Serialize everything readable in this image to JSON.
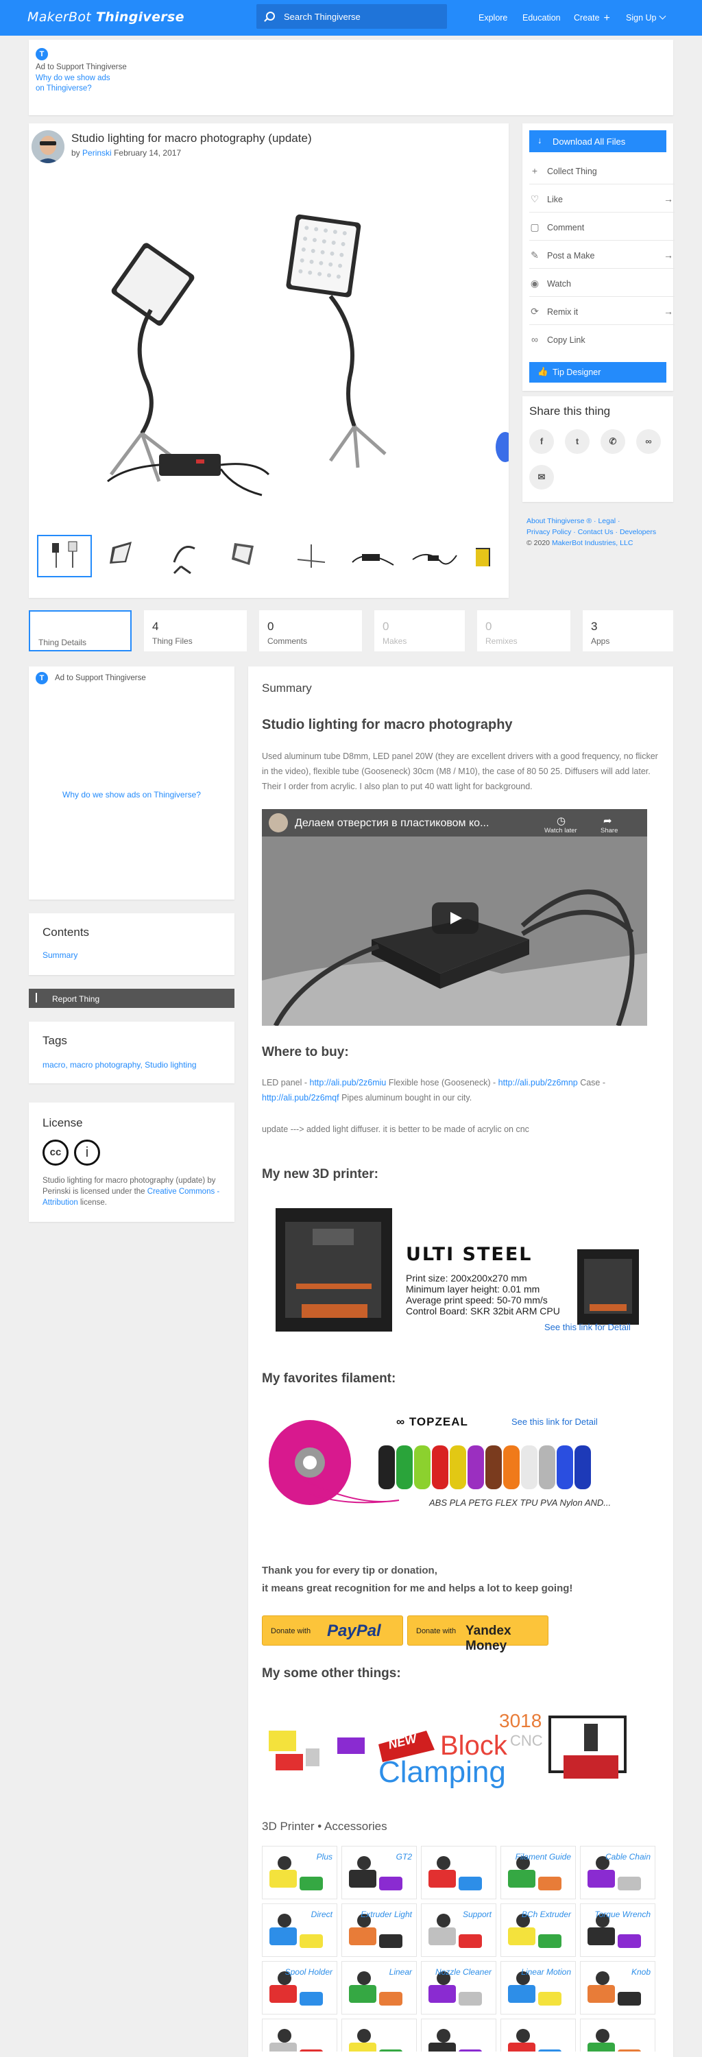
{
  "header": {
    "logo_brand": "MakerBot",
    "logo_product": "Thingiverse",
    "search_placeholder": "Search Thingiverse",
    "nav": [
      "Explore",
      "Education",
      "Create",
      "Sign Up"
    ]
  },
  "top_ad": {
    "label": "Ad to Support Thingiverse",
    "link_line1": "Why do we show ads",
    "link_line2": "on Thingiverse?"
  },
  "thing": {
    "title": "Studio lighting for macro photography (update)",
    "by": "by",
    "author": "Perinski",
    "date": "February 14, 2017"
  },
  "actions": {
    "download": "Download All Files",
    "items": [
      "Collect Thing",
      "Like",
      "Comment",
      "Post a Make",
      "Watch",
      "Remix it",
      "Copy Link"
    ],
    "tip": "Tip Designer"
  },
  "share": {
    "title": "Share this thing",
    "icons": [
      "facebook-icon",
      "twitter-icon",
      "whatsapp-icon",
      "link-icon",
      "mail-icon"
    ]
  },
  "footer": {
    "about": "About Thingiverse ® ·",
    "legal": "Legal ·",
    "privacy": "Privacy Policy ·",
    "contact": "Contact Us ·",
    "developers": "Developers",
    "copyright": "© 2020",
    "company": "MakerBot Industries, LLC"
  },
  "stats": [
    {
      "num": "",
      "label": "Thing Details"
    },
    {
      "num": "4",
      "label": "Thing Files"
    },
    {
      "num": "0",
      "label": "Comments"
    },
    {
      "num": "0",
      "label": "Makes"
    },
    {
      "num": "0",
      "label": "Remixes"
    },
    {
      "num": "3",
      "label": "Apps"
    }
  ],
  "side_ad": {
    "label": "Ad to Support Thingiverse",
    "link": "Why do we show ads on Thingiverse?"
  },
  "contents": {
    "title": "Contents",
    "item": "Summary"
  },
  "report": "Report Thing",
  "tags": {
    "title": "Tags",
    "list": "macro, macro photography, Studio lighting"
  },
  "license": {
    "title": "License",
    "text1": "Studio lighting for macro photography (update) by Perinski is licensed under the",
    "link": "Creative Commons - Attribution",
    "text2": "license."
  },
  "summary": {
    "label": "Summary",
    "heading": "Studio lighting for macro photography",
    "paragraph": "Used aluminum tube D8mm, LED panel 20W (they are excellent drivers with a good frequency, no flicker in the video), flexible tube (Gooseneck) 30cm (M8 / M10), the case of 80 50 25. Diffusers will add later. Their I order from acrylic. I also plan to put 40 watt light for background.",
    "video_title": "Делаем отверстия в пластиковом ко...",
    "video_watch_later": "Watch later",
    "video_share": "Share",
    "where_heading": "Where to buy:",
    "where_led": "LED panel -",
    "where_led_link": "http://ali.pub/2z6miu",
    "where_hose": "Flexible hose (Gooseneck) -",
    "where_hose_link": "http://ali.pub/2z6mnp",
    "where_case": "Case -",
    "where_case_link": "http://ali.pub/2z6mqf",
    "where_tail": "Pipes aluminum bought in our city.",
    "update_note": "update ---> added light diffuser. it is better to be made of acrylic on cnc",
    "printer_heading": "My new 3D printer:",
    "printer_name": "ULTI STEEL",
    "printer_specs": [
      "Print size: 200x200x270 mm",
      "Minimum layer height: 0.01 mm",
      "Average print speed: 50-70 mm/s",
      "Control Board: SKR 32bit ARM CPU"
    ],
    "printer_link": "See this link for Detail",
    "filament_heading": "My favorites filament:",
    "filament_brand": "TOPZEAL",
    "filament_link": "See this link for Detail",
    "filament_types": "ABS PLA PETG FLEX TPU PVA Nylon AND...",
    "thanks_line1": "Thank you for every tip or donation,",
    "thanks_line2": "it means great recognition for me and helps a lot to keep going!",
    "donate_prefix": "Donate with",
    "paypal": "PayPal",
    "yandex": "Yandex Money",
    "other_heading": "My some other things:",
    "other_banner_new": "NEW",
    "other_banner_block": "Block",
    "other_banner_clamping": "Clamping",
    "other_banner_3018": "3018",
    "other_banner_cnc": "CNC",
    "accessories": "3D Printer • Accessories"
  },
  "grid_labels": [
    "Plus",
    "GT2",
    "",
    "Filament Guide",
    "Cable Chain",
    "Direct",
    "Extruder Light",
    "Support",
    "BCh Extruder",
    "Torque Wrench",
    "Spool Holder",
    "Linear",
    "Nozzle Cleaner",
    "Linear Motion",
    "Knob"
  ],
  "colors": {
    "accent": "#248bfb",
    "paypal_yellow": "#fcc43a",
    "report_gray": "#555555"
  }
}
